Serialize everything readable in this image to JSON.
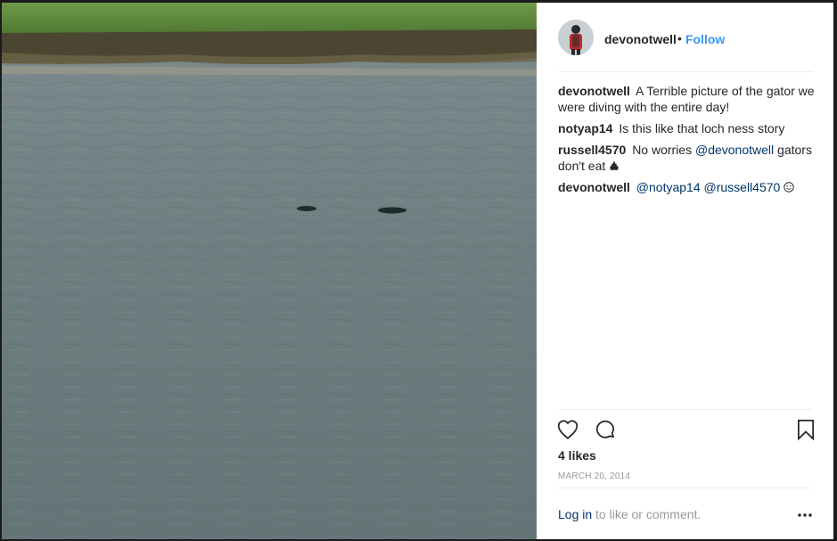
{
  "post": {
    "username": "devonotwell",
    "separator": "•",
    "follow_label": "Follow"
  },
  "comments": [
    {
      "user": "devonotwell",
      "text": "A Terrible picture of the gator we were diving with the entire day!"
    },
    {
      "user": "notyap14",
      "text": "Is this like that loch ness story"
    },
    {
      "user": "russell4570",
      "pre": "No worries ",
      "mention": "@devonotwell",
      "post": " gators don't eat",
      "emoji": "poop-icon"
    },
    {
      "user": "devonotwell",
      "mention1": "@notyap14",
      "mention2": "@russell4570",
      "emoji": "smiley-icon"
    }
  ],
  "stats": {
    "likes": "4 likes",
    "date": "MARCH 20, 2014"
  },
  "footer": {
    "login_link": "Log in",
    "login_text": " to like or comment."
  },
  "icons": {
    "like": "heart-icon",
    "comment": "comment-bubble-icon",
    "save": "bookmark-icon",
    "more": "more-options-icon"
  },
  "colors": {
    "follow": "#3897f0",
    "mention": "#003569",
    "text": "#262626",
    "muted": "#999999",
    "water": "#6d7d80",
    "grass": "#5f8a3a"
  }
}
